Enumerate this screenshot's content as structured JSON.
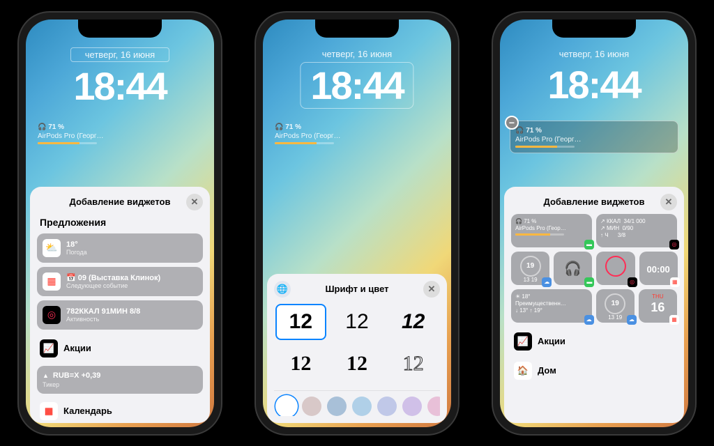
{
  "lockscreen": {
    "date": "четверг, 16 июня",
    "time": "18:44",
    "airpods": {
      "percent": "71 %",
      "name": "AirPods Pro (Георг…"
    }
  },
  "sheet1": {
    "title": "Добавление виджетов",
    "section": "Предложения",
    "suggestions": [
      {
        "icon": "☀️",
        "title": "18°",
        "sub": "Погода"
      },
      {
        "icon": "📅",
        "title": "09 (Выставка Клинок)",
        "sub": "Следующее событие"
      },
      {
        "icon": "◎",
        "title": "782ККАЛ 91МИН 8/8",
        "sub": "Активность"
      }
    ],
    "stocks_label": "Акции",
    "ticker": {
      "symbol": "RUB=X +0,39",
      "sub": "Тикер"
    },
    "calendar_label": "Календарь"
  },
  "sheet2": {
    "title": "Шрифт и цвет",
    "sample": "12",
    "colors": [
      "#ffffff",
      "#d8c8c8",
      "#a8c0d8",
      "#b0d0e8",
      "#c0c8e8",
      "#d0c0e8",
      "#e8c0d8"
    ]
  },
  "sheet3": {
    "title": "Добавление виджетов",
    "w_airpods": {
      "pct": "71 %",
      "name": "AirPods Pro (Геор…"
    },
    "w_fitness": {
      "l1": "ККАЛ",
      "v1": "34/1 000",
      "l2": "МИН",
      "v2": "0/90",
      "l3": "Ч",
      "v3": "3/8"
    },
    "w_ring": "19",
    "w_ring_sub": "13 19",
    "w_clock": "00:00",
    "w_weather": {
      "temp": "18°",
      "desc": "Преимущественн…",
      "range": "↓ 13° ↑ 19°"
    },
    "w_day": {
      "dow": "THU",
      "num": "16"
    },
    "stocks_label": "Акции",
    "home_label": "Дом"
  }
}
